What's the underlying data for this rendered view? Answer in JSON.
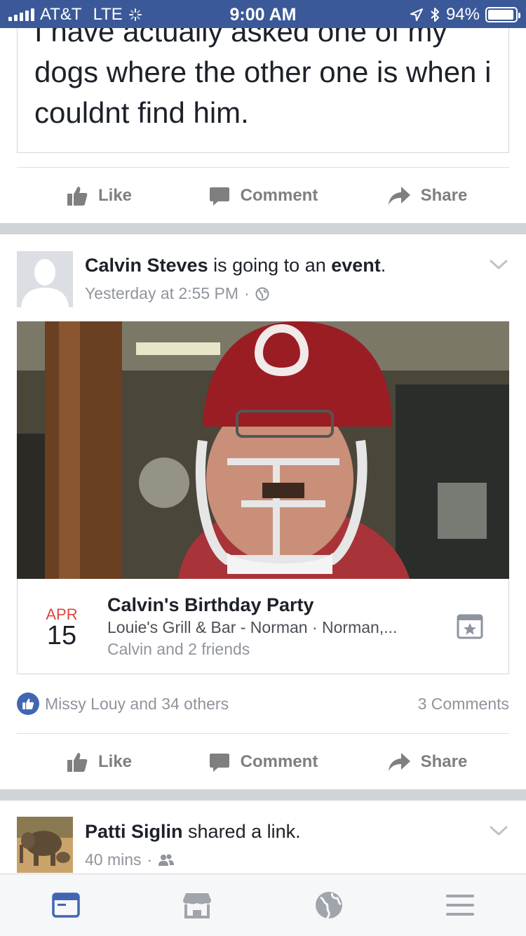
{
  "status_bar": {
    "carrier": "AT&T",
    "network": "LTE",
    "time": "9:00 AM",
    "battery": "94%",
    "battery_level": 0.94
  },
  "post1": {
    "text": "I have actually asked one of my dogs where the other one is when i couldnt find him.",
    "actions": {
      "like": "Like",
      "comment": "Comment",
      "share": "Share"
    }
  },
  "post2": {
    "author": "Calvin Steves",
    "action_text": "is going to an",
    "action_link": "event",
    "action_end": ".",
    "timestamp": "Yesterday at 2:55 PM",
    "privacy_icon": "globe-icon",
    "event": {
      "month": "APR",
      "day": "15",
      "title": "Calvin's Birthday Party",
      "location": "Louie's Grill & Bar - Norman · Norman,...",
      "friends": "Calvin and 2 friends"
    },
    "reactions": "Missy Louy and 34 others",
    "comments": "3 Comments",
    "actions": {
      "like": "Like",
      "comment": "Comment",
      "share": "Share"
    }
  },
  "post3": {
    "author": "Patti Siglin",
    "action_text": "shared a link.",
    "timestamp": "40 mins",
    "privacy_icon": "friends-icon"
  },
  "tab_bar": {
    "tabs": [
      "news-feed-icon",
      "marketplace-icon",
      "globe-icon",
      "menu-icon"
    ],
    "active_color": "#4267b2",
    "inactive_color": "#a0a4ab"
  },
  "colors": {
    "brand": "#3b5998",
    "accent": "#4267b2",
    "date_red": "#e0453c"
  }
}
